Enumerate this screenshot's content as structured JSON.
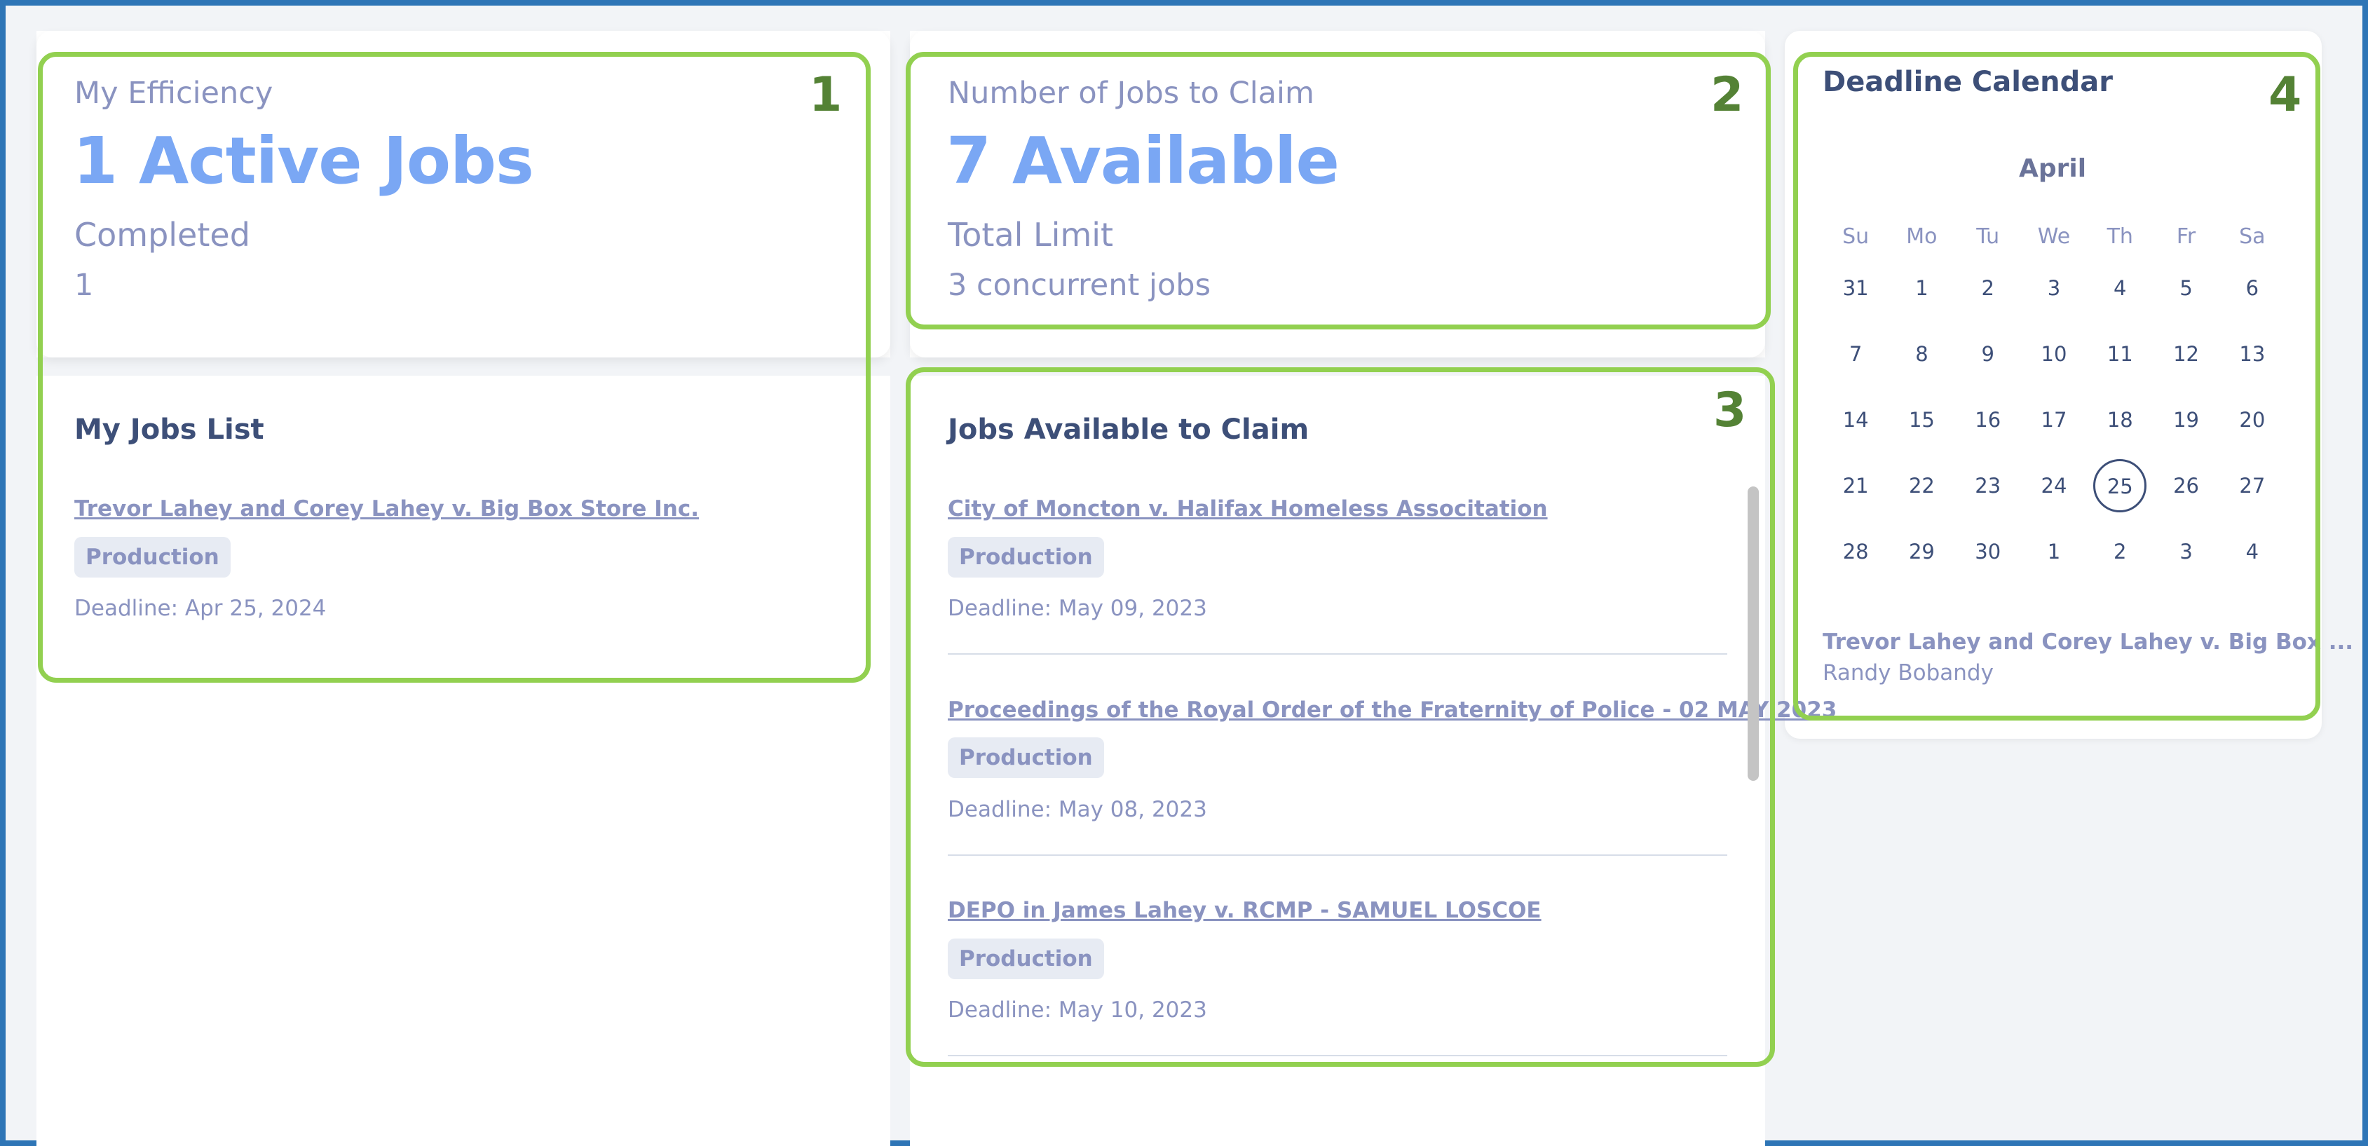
{
  "efficiency": {
    "title": "My Efficiency",
    "active_jobs": "1 Active Jobs",
    "completed_label": "Completed",
    "completed_value": "1"
  },
  "claim_summary": {
    "title": "Number of Jobs to Claim",
    "available": "7 Available",
    "limit_label": "Total Limit",
    "limit_value": "3 concurrent jobs"
  },
  "my_jobs": {
    "title": "My Jobs List",
    "items": [
      {
        "title": "Trevor Lahey and Corey Lahey v. Big Box Store Inc.",
        "tag": "Production",
        "deadline": "Deadline: Apr 25, 2024"
      }
    ]
  },
  "available_jobs": {
    "title": "Jobs Available to Claim",
    "items": [
      {
        "title": "City of Moncton v. Halifax Homeless Associtation",
        "tag": "Production",
        "deadline": "Deadline: May 09, 2023"
      },
      {
        "title": "Proceedings of the Royal Order of the Fraternity of Police - 02 MAY 2023",
        "tag": "Production",
        "deadline": "Deadline: May 08, 2023"
      },
      {
        "title": "DEPO in James Lahey v. RCMP - SAMUEL LOSCOE",
        "tag": "Production",
        "deadline": "Deadline: May 10, 2023"
      }
    ]
  },
  "calendar": {
    "title": "Deadline Calendar",
    "month": "April",
    "weekdays": [
      "Su",
      "Mo",
      "Tu",
      "We",
      "Th",
      "Fr",
      "Sa"
    ],
    "weeks": [
      [
        "31",
        "1",
        "2",
        "3",
        "4",
        "5",
        "6"
      ],
      [
        "7",
        "8",
        "9",
        "10",
        "11",
        "12",
        "13"
      ],
      [
        "14",
        "15",
        "16",
        "17",
        "18",
        "19",
        "20"
      ],
      [
        "21",
        "22",
        "23",
        "24",
        "25",
        "26",
        "27"
      ],
      [
        "28",
        "29",
        "30",
        "1",
        "2",
        "3",
        "4"
      ]
    ],
    "selected_day": "25",
    "event_title": "Trevor Lahey and Corey Lahey v. Big Box ...",
    "event_subtitle": "Randy Bobandy"
  },
  "annotations": [
    "1",
    "2",
    "3",
    "4"
  ],
  "colors": {
    "frame_border": "#2e75b6",
    "highlight": "#92d050",
    "annotation_number": "#548235",
    "stat_blue": "#7aa7f4",
    "muted_text": "#8a93c0",
    "heading": "#3d4f78",
    "tag_bg": "#e7ebf3"
  }
}
